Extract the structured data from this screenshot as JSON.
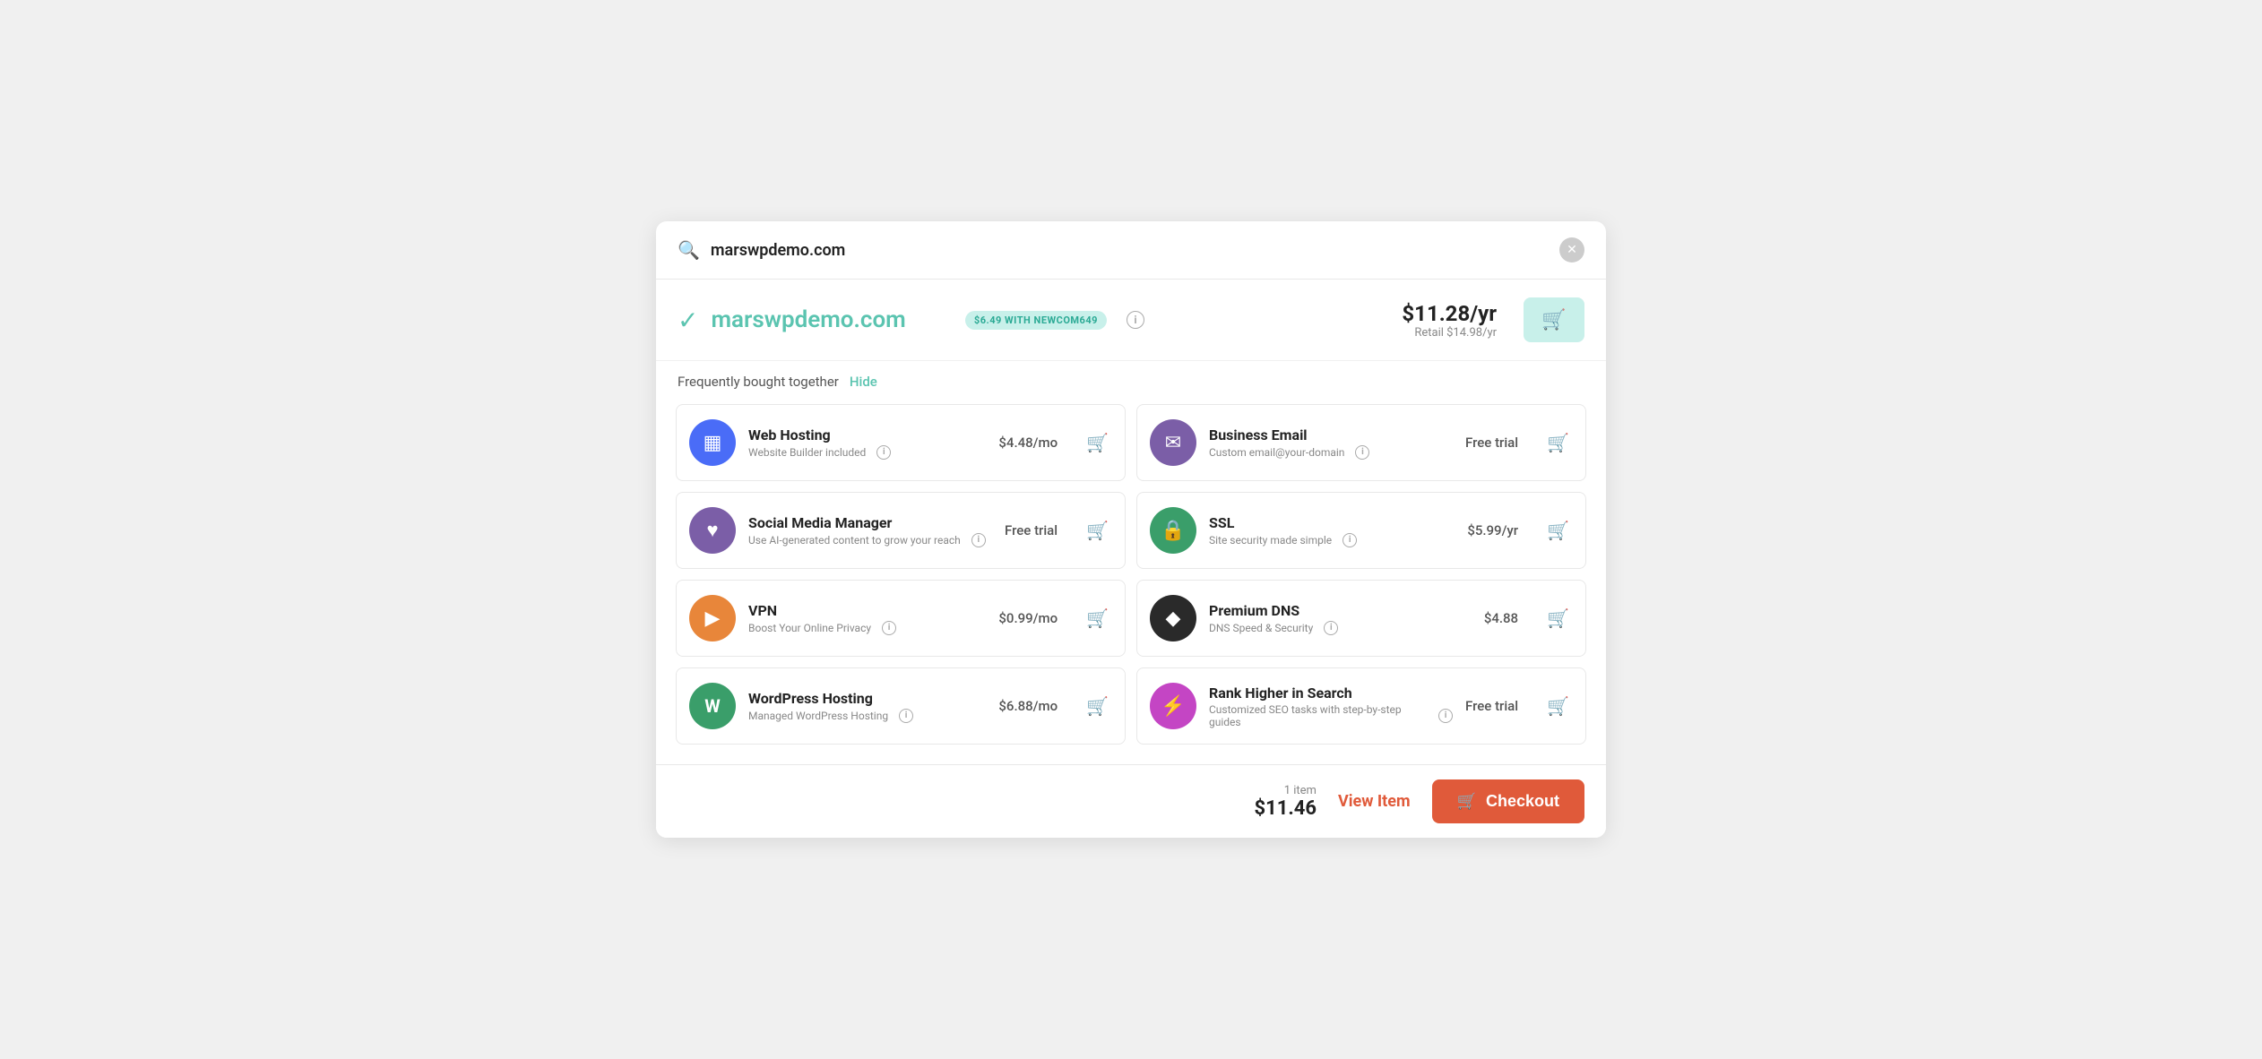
{
  "search": {
    "value": "marswpdemo.com",
    "placeholder": "marswpdemo.com"
  },
  "domain": {
    "name": "marswpdemo.com",
    "promo_badge": "$6.49 WITH NEWCOM649",
    "price_main": "$11.28/yr",
    "price_retail": "Retail $14.98/yr",
    "info_label": "i"
  },
  "fbt": {
    "title": "Frequently bought together",
    "hide_label": "Hide"
  },
  "products": [
    {
      "id": "web-hosting",
      "name": "Web Hosting",
      "description": "Website Builder included",
      "price": "$4.48/mo",
      "icon_color": "#4a6cf7",
      "icon_symbol": "▦"
    },
    {
      "id": "business-email",
      "name": "Business Email",
      "description": "Custom email@your-domain",
      "price": "Free trial",
      "icon_color": "#7b5ea7",
      "icon_symbol": "✉"
    },
    {
      "id": "social-media",
      "name": "Social Media Manager",
      "description": "Use AI-generated content to grow your reach",
      "price": "Free trial",
      "icon_color": "#7b5ea7",
      "icon_symbol": "♥"
    },
    {
      "id": "ssl",
      "name": "SSL",
      "description": "Site security made simple",
      "price": "$5.99/yr",
      "icon_color": "#3a9e6a",
      "icon_symbol": "🔒"
    },
    {
      "id": "vpn",
      "name": "VPN",
      "description": "Boost Your Online Privacy",
      "price": "$0.99/mo",
      "icon_color": "#e8863a",
      "icon_symbol": "▶"
    },
    {
      "id": "premium-dns",
      "name": "Premium DNS",
      "description": "DNS Speed & Security",
      "price": "$4.88",
      "icon_color": "#2a2a2a",
      "icon_symbol": "◆"
    },
    {
      "id": "wordpress",
      "name": "WordPress Hosting",
      "description": "Managed WordPress Hosting",
      "price": "$6.88/mo",
      "icon_color": "#3a9e6a",
      "icon_symbol": "W"
    },
    {
      "id": "rank-search",
      "name": "Rank Higher in Search",
      "description": "Customized SEO tasks with step-by-step guides",
      "price": "Free trial",
      "icon_color": "#c445c4",
      "icon_symbol": "⚡"
    }
  ],
  "footer": {
    "items_label": "1 item",
    "total_amount": "$11.46",
    "view_item_label": "View Item",
    "checkout_label": "Checkout"
  }
}
